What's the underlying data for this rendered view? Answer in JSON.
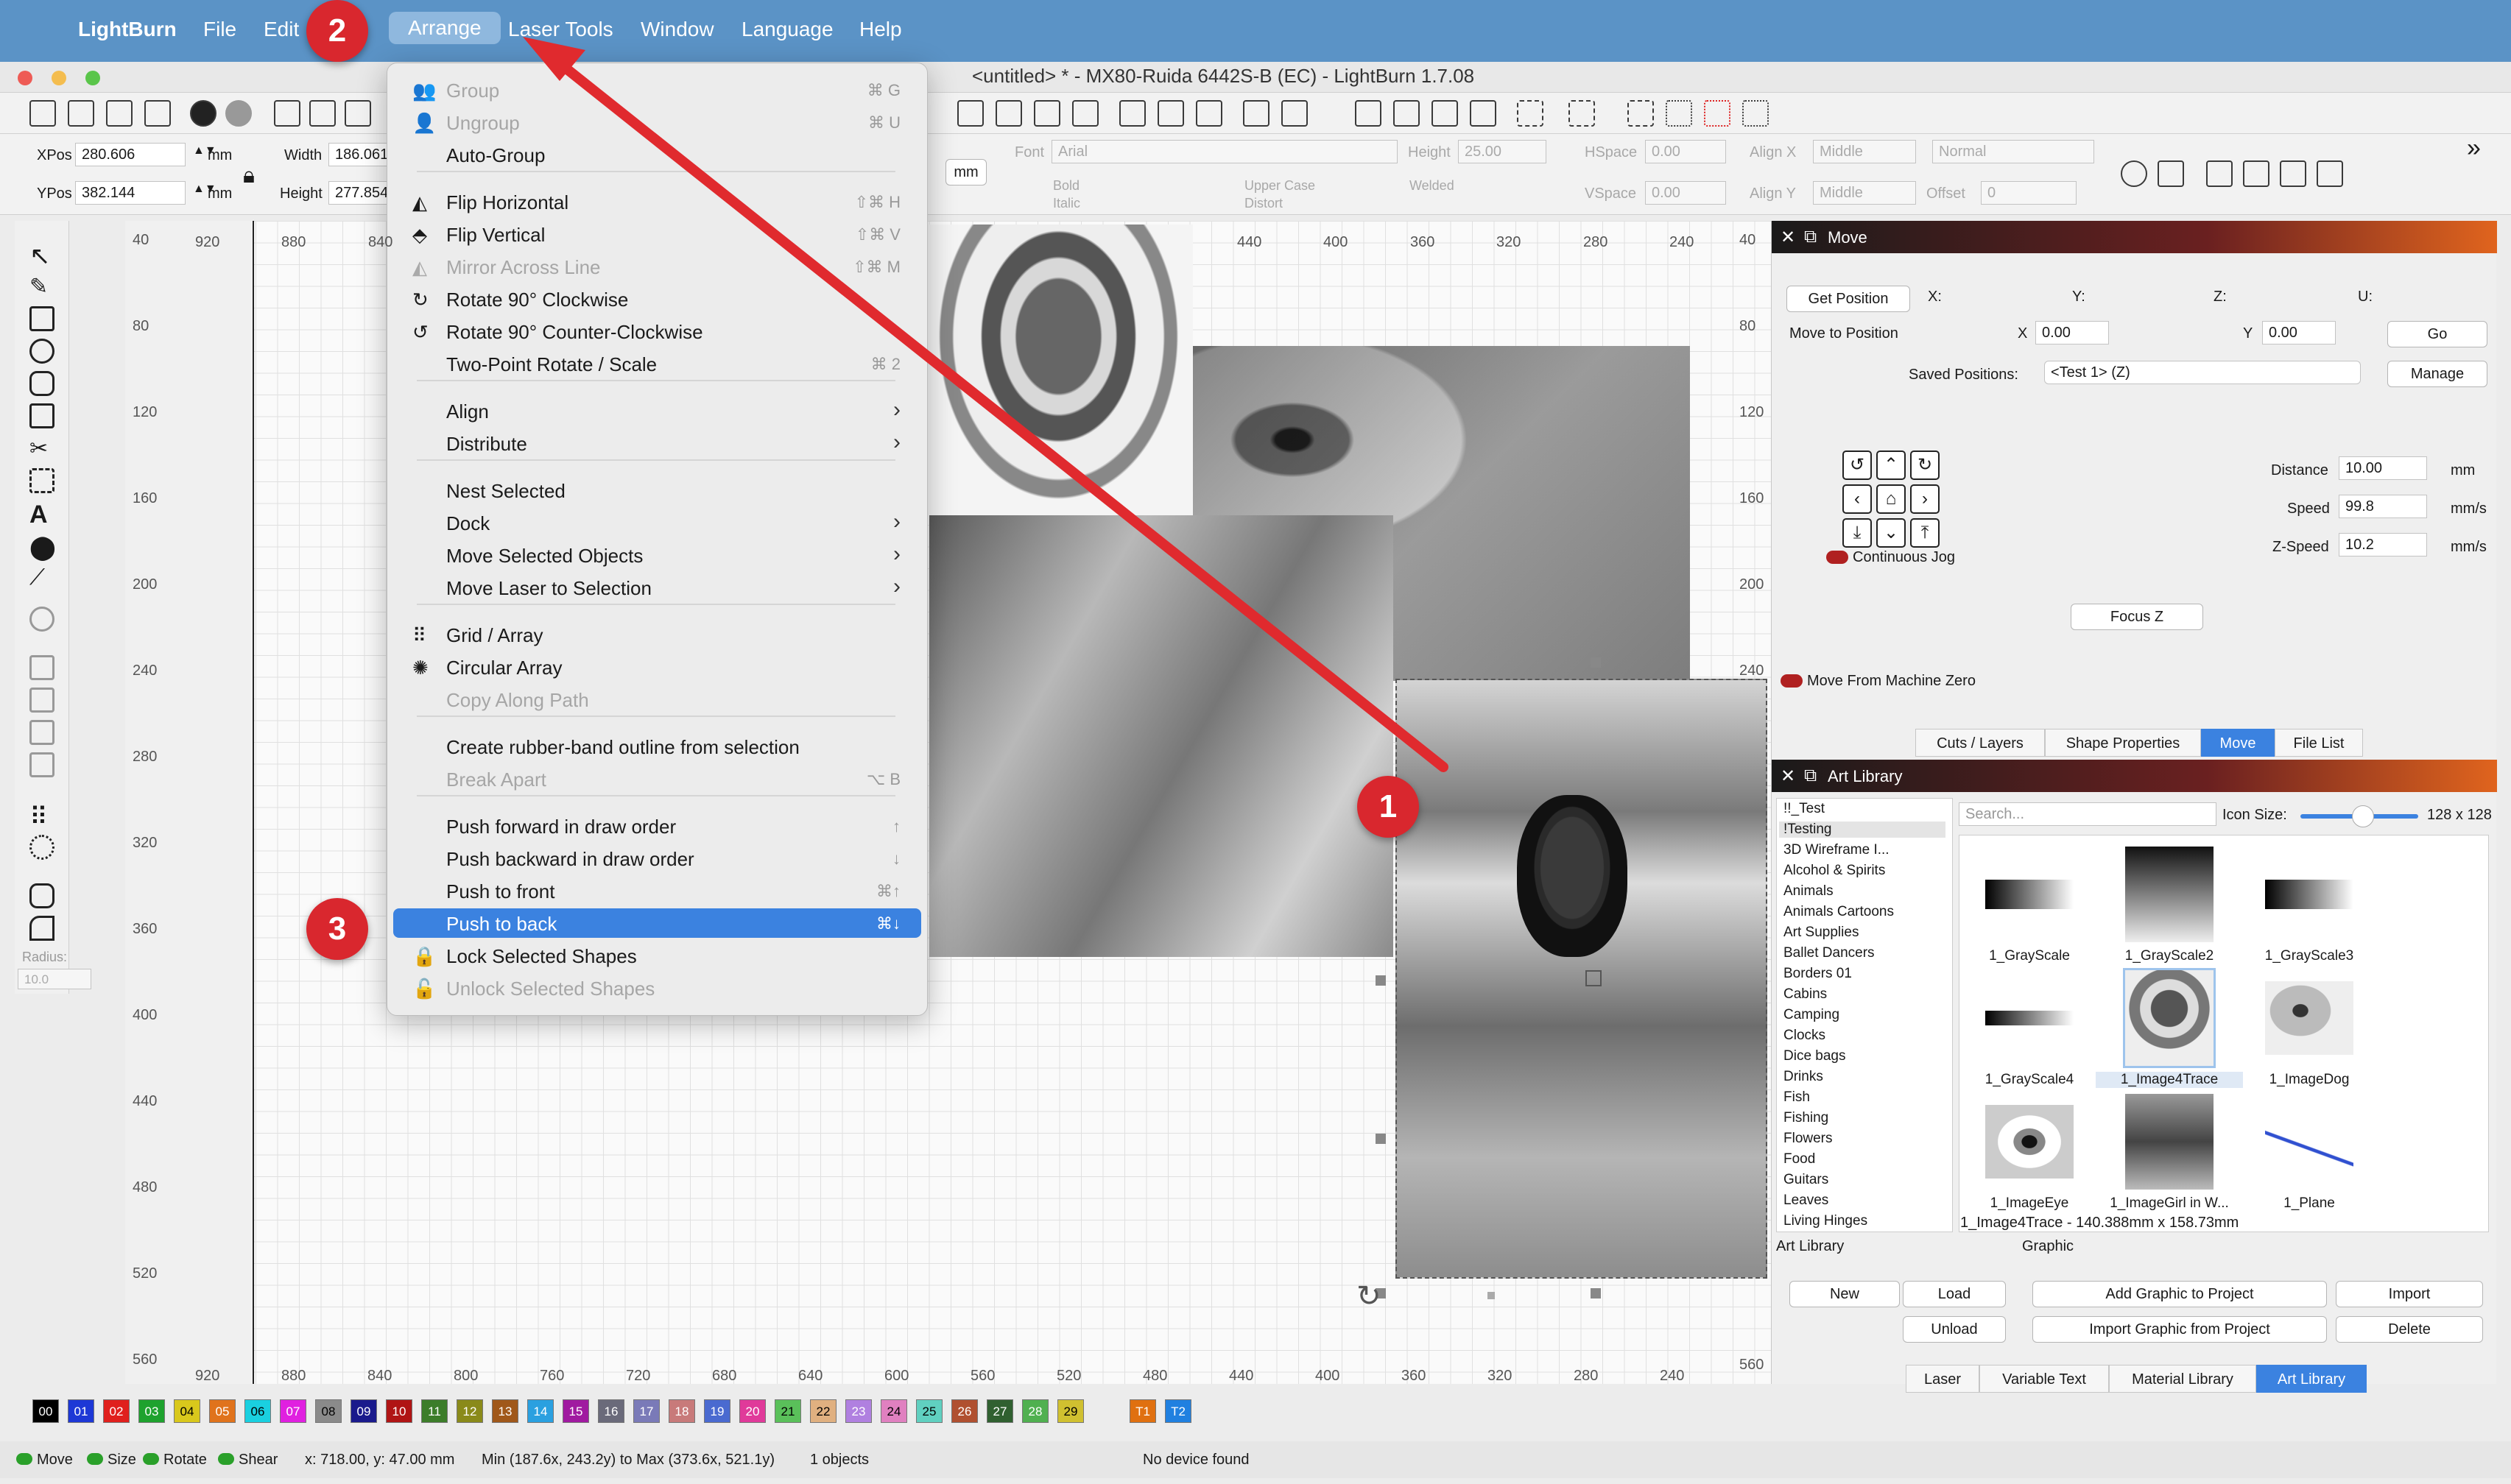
{
  "menubar": {
    "app": "LightBurn",
    "items": [
      "File",
      "Edit",
      "Arrange",
      "Laser Tools",
      "Window",
      "Language",
      "Help"
    ]
  },
  "window": {
    "title": "<untitled> * - MX80-Ruida 6442S-B (EC) - LightBurn 1.7.08"
  },
  "position": {
    "xpos_label": "XPos",
    "xpos_value": "280.606",
    "ypos_label": "YPos",
    "ypos_value": "382.144",
    "width_label": "Width",
    "width_value": "186.061",
    "height_label": "Height",
    "height_value": "277.854",
    "unit": "mm",
    "unit_button": "mm"
  },
  "text_options": {
    "font_label": "Font",
    "font_value": "Arial",
    "height_label": "Height",
    "height_value": "25.00",
    "hspace_label": "HSpace",
    "hspace_value": "0.00",
    "vspace_label": "VSpace",
    "vspace_value": "0.00",
    "alignx_label": "Align X",
    "alignx_value": "Middle",
    "aligny_label": "Align Y",
    "aligny_value": "Middle",
    "mode_value": "Normal",
    "offset_label": "Offset",
    "offset_value": "0",
    "bold": "Bold",
    "italic": "Italic",
    "upper": "Upper Case",
    "distort": "Distort",
    "welded": "Welded"
  },
  "left_tools": {
    "radius_label": "Radius:",
    "radius_value": "10.0"
  },
  "rulers": {
    "top": [
      "920",
      "880",
      "840",
      "440",
      "400",
      "360",
      "320",
      "280",
      "240"
    ],
    "bottom": [
      "920",
      "880",
      "840",
      "800",
      "760",
      "720",
      "680",
      "640",
      "600",
      "560",
      "520",
      "480",
      "440",
      "400",
      "360",
      "320",
      "280",
      "240"
    ],
    "left": [
      "40",
      "80",
      "120",
      "160",
      "200",
      "240",
      "280",
      "320",
      "360",
      "400",
      "440",
      "480",
      "520",
      "560"
    ],
    "right": [
      "40",
      "80",
      "120",
      "160",
      "200",
      "240"
    ]
  },
  "arrange_menu": {
    "items": [
      {
        "label": "Group",
        "key": "⌘ G",
        "disabled": true
      },
      {
        "label": "Ungroup",
        "key": "⌘ U",
        "disabled": true
      },
      {
        "label": "Auto-Group",
        "key": "",
        "disabled": false
      },
      {
        "label": "Flip Horizontal",
        "key": "⇧⌘ H",
        "disabled": false
      },
      {
        "label": "Flip Vertical",
        "key": "⇧⌘ V",
        "disabled": false
      },
      {
        "label": "Mirror Across Line",
        "key": "⇧⌘ M",
        "disabled": true
      },
      {
        "label": "Rotate 90° Clockwise",
        "key": "",
        "disabled": false
      },
      {
        "label": "Rotate 90° Counter-Clockwise",
        "key": "",
        "disabled": false
      },
      {
        "label": "Two-Point Rotate / Scale",
        "key": "⌘ 2",
        "disabled": false
      },
      {
        "label": "Align",
        "key": "",
        "disabled": false
      },
      {
        "label": "Distribute",
        "key": "",
        "disabled": false
      },
      {
        "label": "Nest Selected",
        "key": "",
        "disabled": false
      },
      {
        "label": "Dock",
        "key": "",
        "disabled": false
      },
      {
        "label": "Move Selected Objects",
        "key": "",
        "disabled": false
      },
      {
        "label": "Move Laser to Selection",
        "key": "",
        "disabled": false
      },
      {
        "label": "Grid / Array",
        "key": "",
        "disabled": false
      },
      {
        "label": "Circular Array",
        "key": "",
        "disabled": false
      },
      {
        "label": "Copy Along Path",
        "key": "",
        "disabled": true
      },
      {
        "label": "Create rubber-band outline from selection",
        "key": "",
        "disabled": false
      },
      {
        "label": "Break Apart",
        "key": "⌥ B",
        "disabled": true
      },
      {
        "label": "Push forward in draw order",
        "key": "↑",
        "disabled": false
      },
      {
        "label": "Push backward in draw order",
        "key": "↓",
        "disabled": false
      },
      {
        "label": "Push to front",
        "key": "⌘↑",
        "disabled": false
      },
      {
        "label": "Push to back",
        "key": "⌘↓",
        "disabled": false
      },
      {
        "label": "Lock Selected Shapes",
        "key": "",
        "disabled": false
      },
      {
        "label": "Unlock Selected Shapes",
        "key": "",
        "disabled": true
      }
    ]
  },
  "move_panel": {
    "title": "Move",
    "get_position": "Get Position",
    "x_label": "X:",
    "y_label": "Y:",
    "z_label": "Z:",
    "u_label": "U:",
    "move_to": "Move to Position",
    "mx_label": "X",
    "mx_value": "0.00",
    "my_label": "Y",
    "my_value": "0.00",
    "go": "Go",
    "saved_label": "Saved Positions:",
    "saved_value": "<Test 1> (Z)",
    "manage": "Manage",
    "distance_label": "Distance",
    "distance_value": "10.00",
    "distance_unit": "mm",
    "speed_label": "Speed",
    "speed_value": "99.8",
    "speed_unit": "mm/s",
    "zspeed_label": "Z-Speed",
    "zspeed_value": "10.2",
    "zspeed_unit": "mm/s",
    "continuous": "Continuous Jog",
    "focus": "Focus Z",
    "from_zero": "Move From Machine Zero",
    "tabs": [
      "Cuts / Layers",
      "Shape Properties",
      "Move",
      "File List"
    ]
  },
  "art_library": {
    "title": "Art Library",
    "search_placeholder": "Search...",
    "icon_size_label": "Icon Size:",
    "icon_size_value": "128 x 128",
    "libraries": [
      "!!_Test",
      "!Testing",
      "3D Wireframe I...",
      "Alcohol & Spirits",
      "Animals",
      "Animals Cartoons",
      "Art Supplies",
      "Ballet Dancers",
      "Borders 01",
      "Cabins",
      "Camping",
      "Clocks",
      "Dice bags",
      "Drinks",
      "Fish",
      "Fishing",
      "Flowers",
      "Food",
      "Guitars",
      "Leaves",
      "Living Hinges"
    ],
    "thumbs": [
      "1_GrayScale",
      "1_GrayScale2",
      "1_GrayScale3",
      "1_GrayScale4",
      "1_Image4Trace",
      "1_ImageDog",
      "1_ImageEye",
      "1_ImageGirl in W...",
      "1_Plane"
    ],
    "selected_info": "1_Image4Trace - 140.388mm x 158.73mm",
    "section_art": "Art Library",
    "section_graphic": "Graphic",
    "btn_new": "New",
    "btn_load": "Load",
    "btn_unload": "Unload",
    "btn_add": "Add Graphic to Project",
    "btn_import_from": "Import Graphic from Project",
    "btn_import": "Import",
    "btn_delete": "Delete",
    "bottom_tabs": [
      "Laser",
      "Variable Text",
      "Material Library",
      "Art Library"
    ]
  },
  "swatches": {
    "labels": [
      "00",
      "01",
      "02",
      "03",
      "04",
      "05",
      "06",
      "07",
      "08",
      "09",
      "10",
      "11",
      "12",
      "13",
      "14",
      "15",
      "16",
      "17",
      "18",
      "19",
      "20",
      "21",
      "22",
      "23",
      "24",
      "25",
      "26",
      "27",
      "28",
      "29",
      "T1",
      "T2"
    ],
    "colors": [
      "#000000",
      "#1d38d6",
      "#e0201d",
      "#1ea22e",
      "#d9c81c",
      "#e0731c",
      "#1ad0e0",
      "#e020e0",
      "#8a8a8a",
      "#1a1a8c",
      "#b01414",
      "#3c7d2a",
      "#8a8a1a",
      "#a0581a",
      "#2aa0e0",
      "#a01aa0",
      "#6a6a7a",
      "#7a7ab8",
      "#c87a7a",
      "#4a6ad0",
      "#e03a9a",
      "#5ac05a",
      "#e0b080",
      "#b080e0",
      "#e080c0",
      "#60d0c0",
      "#b05030",
      "#306030",
      "#50b050",
      "#d0c030",
      "#e07010",
      "#2080e0"
    ]
  },
  "status": {
    "move": "Move",
    "size": "Size",
    "rotate": "Rotate",
    "shear": "Shear",
    "coords": "x: 718.00, y: 47.00 mm",
    "bounds": "Min (187.6x, 243.2y) to Max (373.6x, 521.1y)",
    "objects": "1 objects",
    "device": "No device found"
  },
  "annotations": {
    "b1": "1",
    "b2": "2",
    "b3": "3",
    "arrow_color": "#e02a2e"
  }
}
